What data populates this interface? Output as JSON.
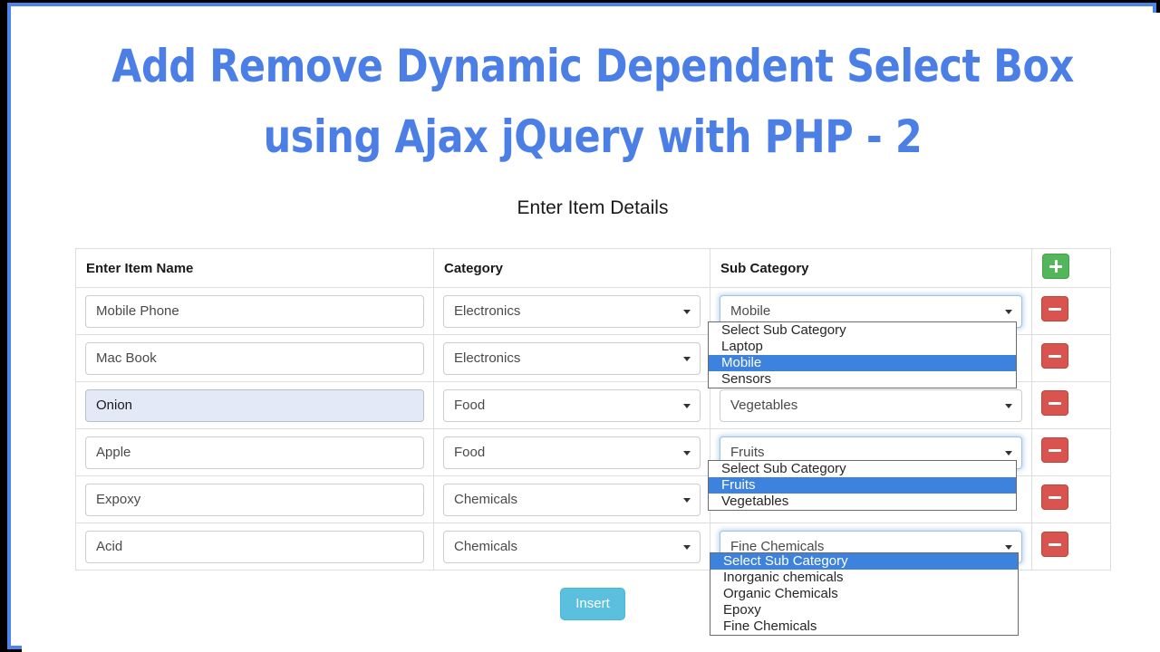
{
  "page": {
    "title_line1": "Add Remove Dynamic Dependent Select Box",
    "title_line2": "using Ajax jQuery with PHP - 2",
    "subtitle": "Enter Item Details",
    "title_color": "#4c7fe6",
    "frame_color": "#4c86e8",
    "highlight_color": "#3d82dd"
  },
  "table": {
    "headers": {
      "name": "Enter Item Name",
      "category": "Category",
      "subcategory": "Sub Category",
      "action_add": "+"
    },
    "rows": [
      {
        "item_name": "Mobile Phone",
        "category": "Electronics",
        "subcategory": "Mobile",
        "remove_label": "-"
      },
      {
        "item_name": "Mac Book",
        "category": "Electronics",
        "subcategory": "",
        "remove_label": "-"
      },
      {
        "item_name": "Onion",
        "category": "Food",
        "subcategory": "Vegetables",
        "remove_label": "-"
      },
      {
        "item_name": "Apple",
        "category": "Food",
        "subcategory": "Fruits",
        "remove_label": "-"
      },
      {
        "item_name": "Expoxy",
        "category": "Chemicals",
        "subcategory": "",
        "remove_label": "-"
      },
      {
        "item_name": "Acid",
        "category": "Chemicals",
        "subcategory": "Fine Chemicals",
        "remove_label": "-"
      }
    ]
  },
  "open_dropdowns": {
    "electronics": {
      "options": [
        "Select Sub Category",
        "Laptop",
        "Mobile",
        "Sensors"
      ],
      "selected": "Mobile"
    },
    "food": {
      "options": [
        "Select Sub Category",
        "Fruits",
        "Vegetables"
      ],
      "selected": "Fruits"
    },
    "chemicals": {
      "options": [
        "Select Sub Category",
        "Inorganic chemicals",
        "Organic Chemicals",
        "Epoxy",
        "Fine Chemicals"
      ],
      "selected": "Select Sub Category"
    }
  },
  "footer": {
    "insert_label": "Insert"
  }
}
